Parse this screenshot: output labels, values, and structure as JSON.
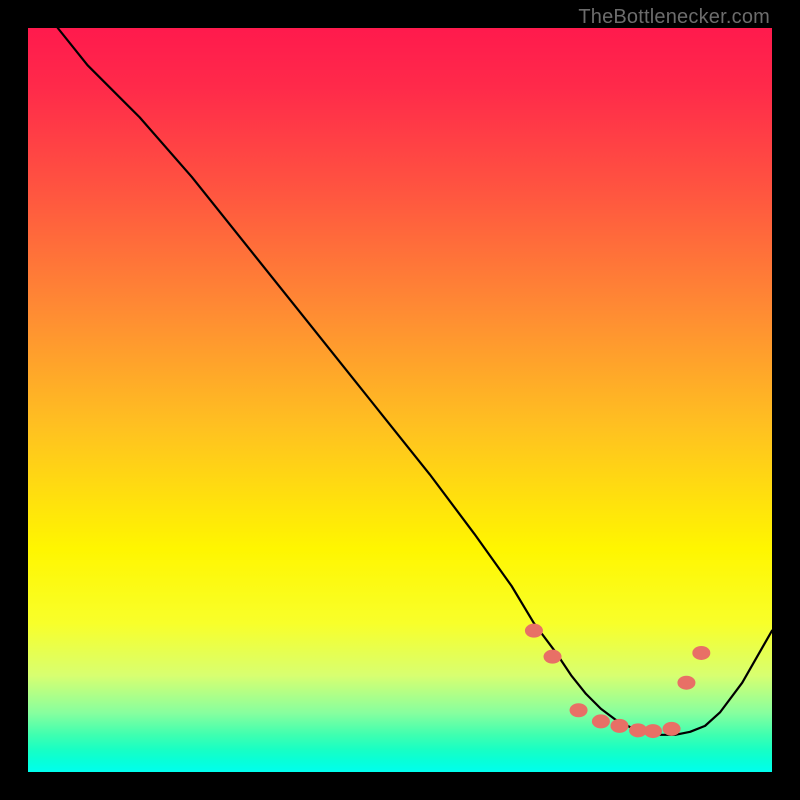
{
  "attribution": "TheBottlenecker.com",
  "chart_data": {
    "type": "line",
    "title": "",
    "xlabel": "",
    "ylabel": "",
    "xlim": [
      0,
      100
    ],
    "ylim": [
      0,
      100
    ],
    "series": [
      {
        "name": "curve",
        "x": [
          4,
          8,
          15,
          22,
          30,
          38,
          46,
          54,
          60,
          65,
          68,
          71,
          73,
          75,
          77,
          79,
          81,
          83,
          85,
          87,
          89,
          91,
          93,
          96,
          100
        ],
        "y": [
          100,
          95,
          88,
          80,
          70,
          60,
          50,
          40,
          32,
          25,
          20,
          16,
          13,
          10.5,
          8.5,
          7,
          6,
          5.5,
          5,
          5,
          5.4,
          6.2,
          8,
          12,
          19
        ]
      }
    ],
    "markers": {
      "name": "dots",
      "x": [
        68,
        70.5,
        74,
        77,
        79.5,
        82,
        84,
        86.5,
        88.5,
        90.5
      ],
      "y": [
        19,
        15.5,
        8.3,
        6.8,
        6.2,
        5.6,
        5.5,
        5.8,
        12,
        16
      ]
    }
  },
  "colors": {
    "line": "#000000",
    "marker": "#e87066",
    "gradient_top": "#ff1a4d",
    "gradient_bottom": "#00ffee",
    "frame": "#000000",
    "attribution": "#6c6c6c"
  }
}
